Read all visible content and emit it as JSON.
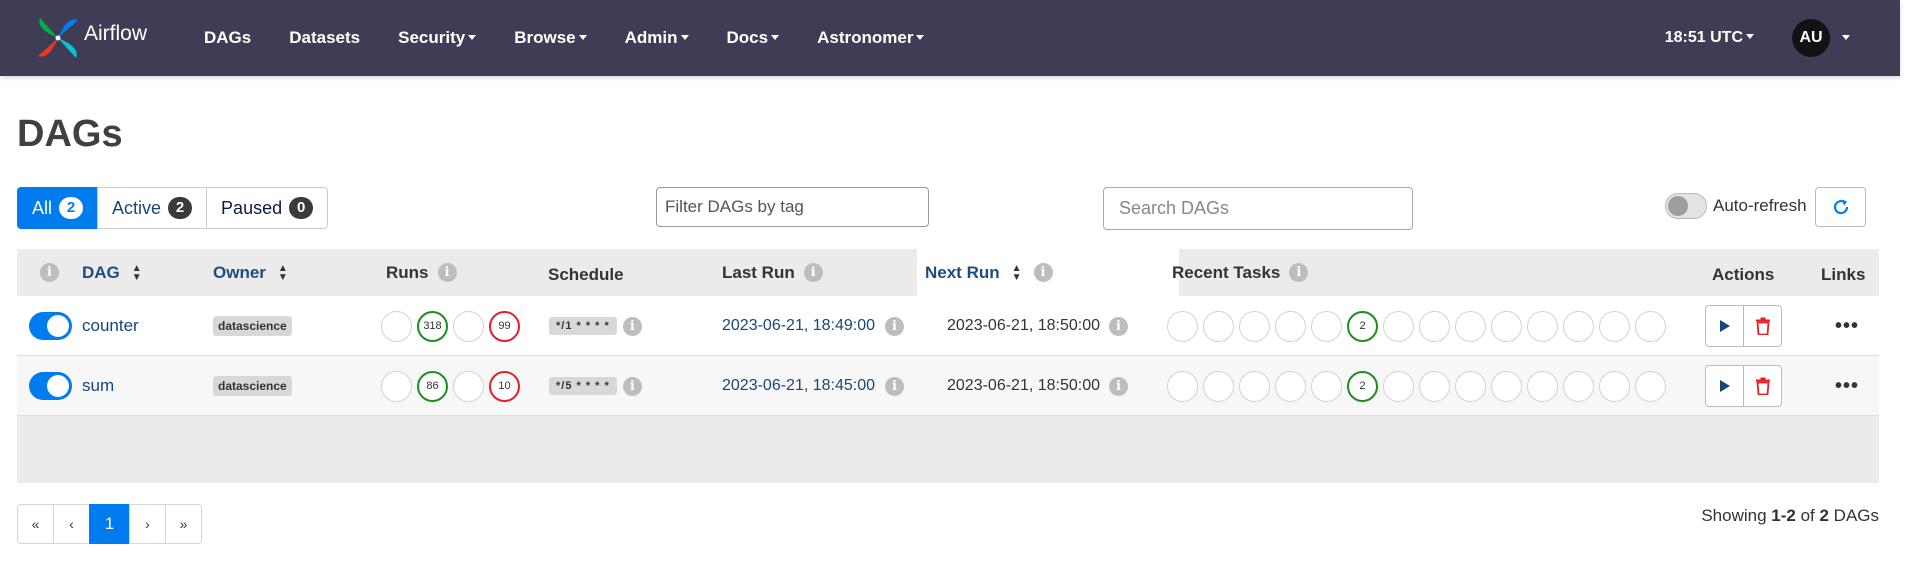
{
  "navbar": {
    "brand": "Airflow",
    "items": [
      {
        "label": "DAGs",
        "dropdown": false
      },
      {
        "label": "Datasets",
        "dropdown": false
      },
      {
        "label": "Security",
        "dropdown": true
      },
      {
        "label": "Browse",
        "dropdown": true
      },
      {
        "label": "Admin",
        "dropdown": true
      },
      {
        "label": "Docs",
        "dropdown": true
      },
      {
        "label": "Astronomer",
        "dropdown": true
      }
    ],
    "clock": "18:51 UTC",
    "avatar": "AU"
  },
  "page": {
    "title": "DAGs"
  },
  "filters": {
    "all": {
      "label": "All",
      "count": "2"
    },
    "active": {
      "label": "Active",
      "count": "2"
    },
    "paused": {
      "label": "Paused",
      "count": "0"
    }
  },
  "tag_filter": {
    "placeholder": "Filter DAGs by tag"
  },
  "search": {
    "placeholder": "Search DAGs"
  },
  "auto_refresh": {
    "label": "Auto-refresh",
    "enabled": false
  },
  "table": {
    "headers": {
      "dag": "DAG",
      "owner": "Owner",
      "runs": "Runs",
      "schedule": "Schedule",
      "last_run": "Last Run",
      "next_run": "Next Run",
      "recent_tasks": "Recent Tasks",
      "actions": "Actions",
      "links": "Links"
    },
    "rows": [
      {
        "name": "counter",
        "enabled": true,
        "owner": "datascience",
        "runs": [
          "",
          "318",
          "",
          "99"
        ],
        "schedule": "*/1 * * * *",
        "last_run": "2023-06-21, 18:49:00",
        "next_run": "2023-06-21, 18:50:00",
        "recent_tasks": [
          "",
          "",
          "",
          "",
          "",
          "2",
          "",
          "",
          "",
          "",
          "",
          "",
          "",
          ""
        ],
        "links": "•••"
      },
      {
        "name": "sum",
        "enabled": true,
        "owner": "datascience",
        "runs": [
          "",
          "86",
          "",
          "10"
        ],
        "schedule": "*/5 * * * *",
        "last_run": "2023-06-21, 18:45:00",
        "next_run": "2023-06-21, 18:50:00",
        "recent_tasks": [
          "",
          "",
          "",
          "",
          "",
          "2",
          "",
          "",
          "",
          "",
          "",
          "",
          "",
          ""
        ],
        "links": "•••"
      }
    ]
  },
  "pagination": {
    "first": "«",
    "prev": "‹",
    "current": "1",
    "next": "›",
    "last": "»",
    "showing_prefix": "Showing ",
    "showing_range": "1-2",
    "showing_mid": " of ",
    "showing_total": "2",
    "showing_suffix": " DAGs"
  },
  "colors": {
    "navbar_bg": "#3f3d56",
    "primary": "#017cee",
    "success": "#1c8f1c",
    "failed": "#e3202a",
    "delete": "#e3202a"
  }
}
